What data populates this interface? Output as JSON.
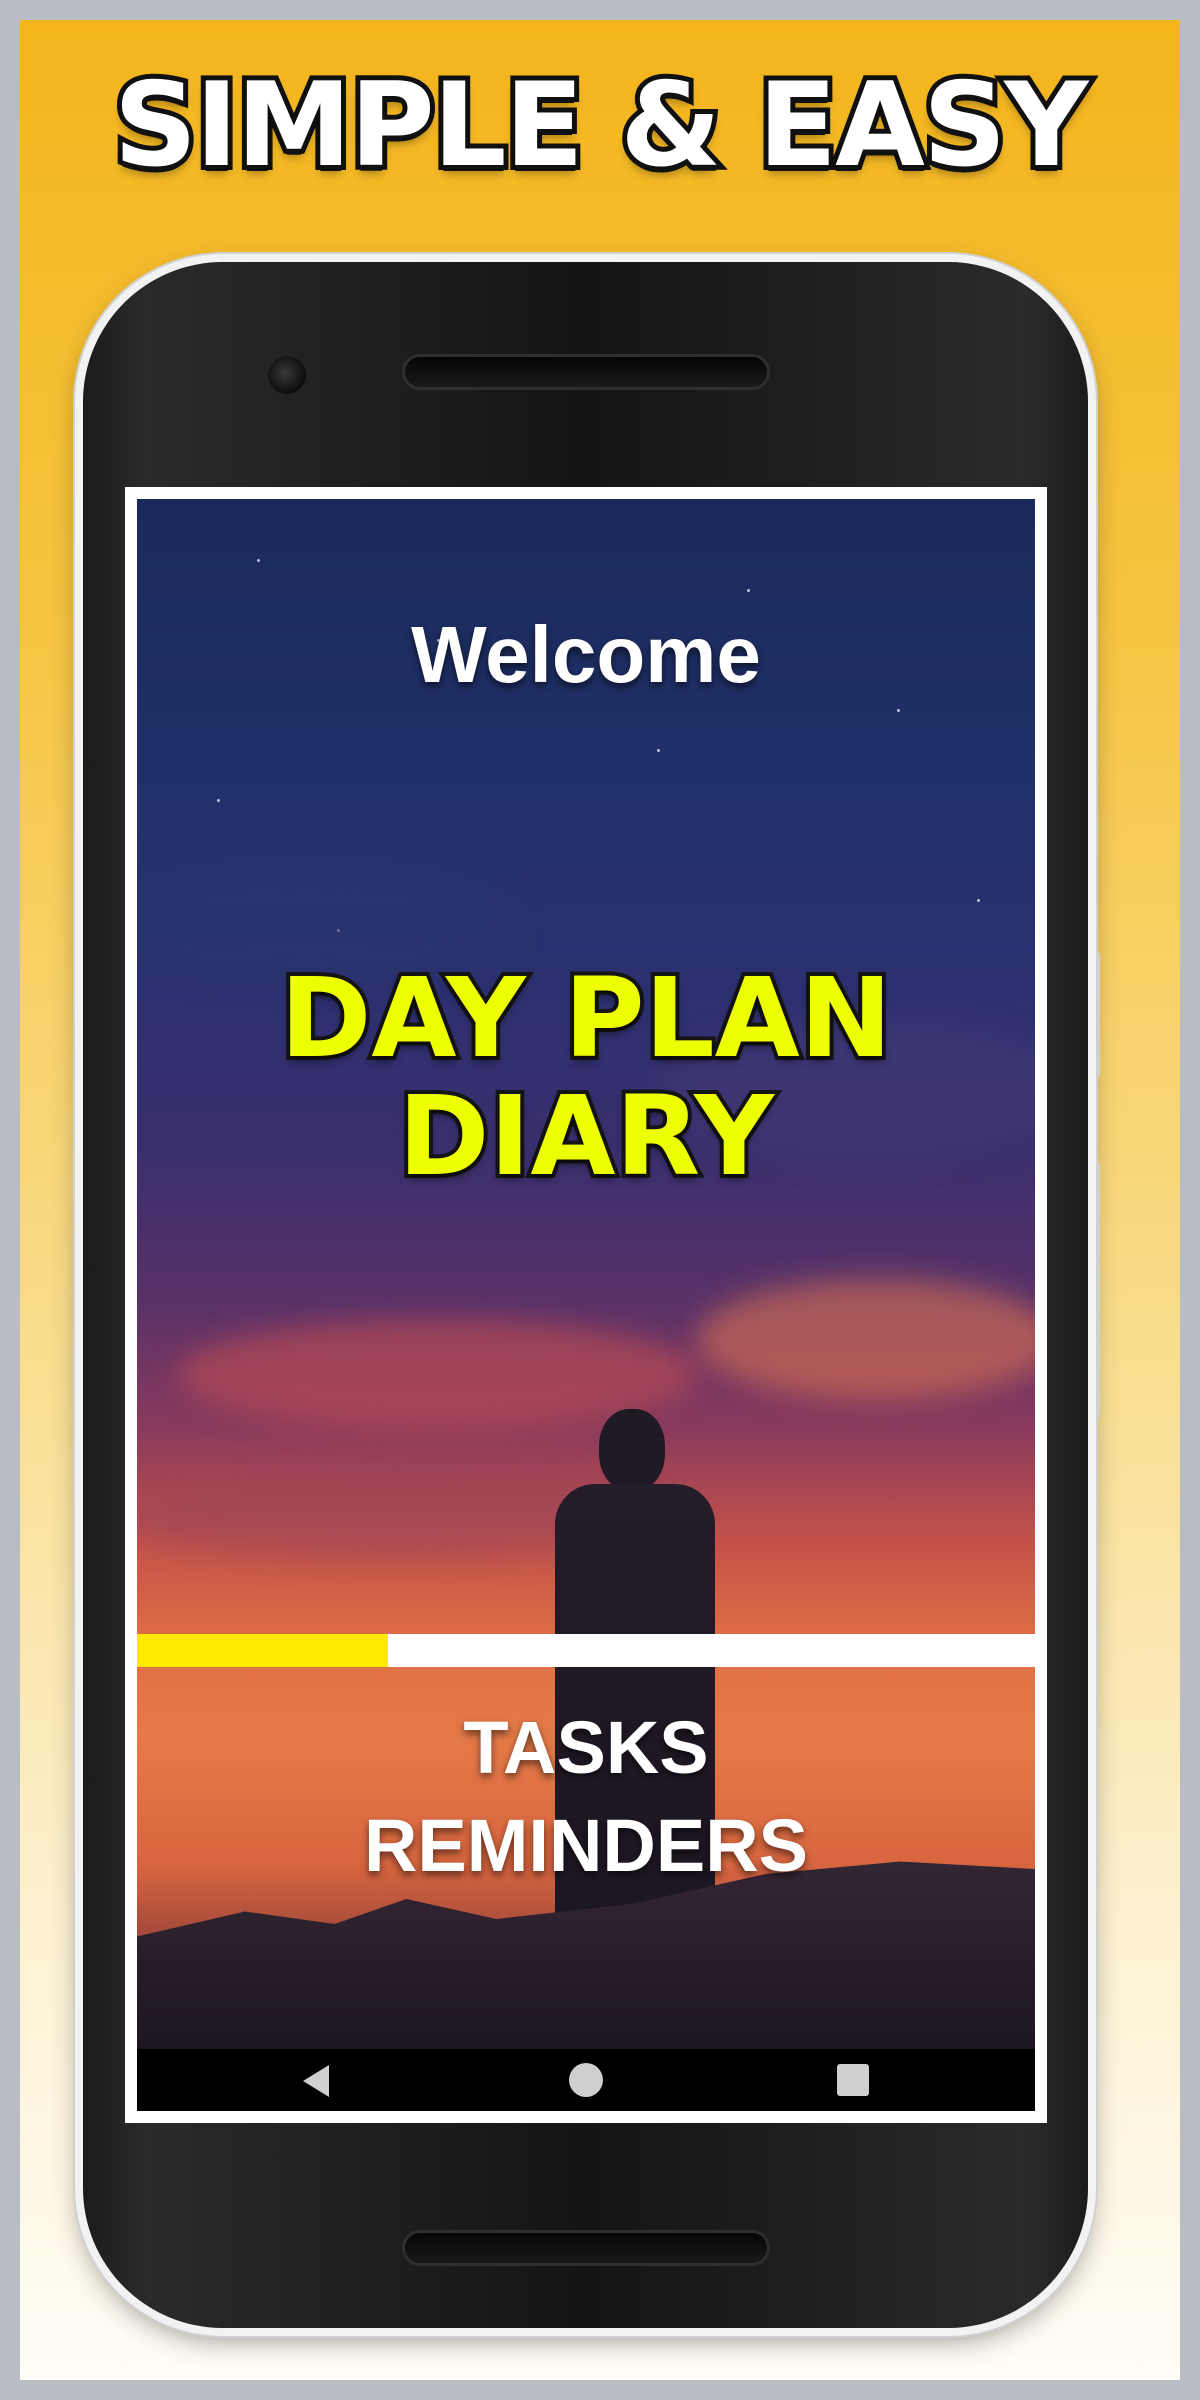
{
  "banner": {
    "headline": "SIMPLE & EASY"
  },
  "app": {
    "welcome": "Welcome",
    "title_line1": "DAY PLAN",
    "title_line2": "DIARY",
    "features": [
      "TASKS",
      "REMINDERS"
    ],
    "progress": 0.28
  },
  "navigation": {
    "back": "back-icon",
    "home": "home-icon",
    "recents": "recents-icon"
  },
  "colors": {
    "banner_background": "#f4b51c",
    "title_yellow": "#eeff00",
    "progress_fill": "#ffea00"
  }
}
